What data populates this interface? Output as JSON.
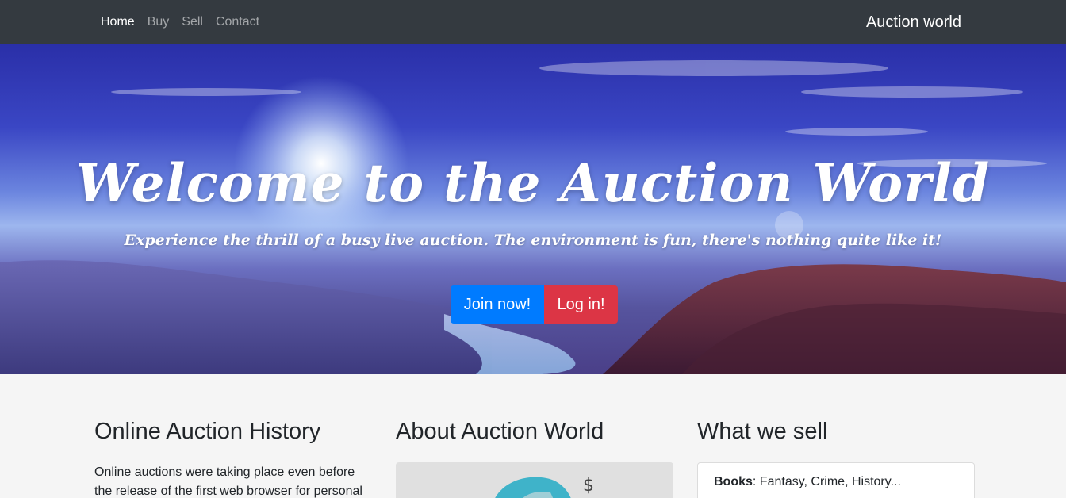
{
  "nav": {
    "links": [
      {
        "label": "Home",
        "active": true
      },
      {
        "label": "Buy",
        "active": false
      },
      {
        "label": "Sell",
        "active": false
      },
      {
        "label": "Contact",
        "active": false
      }
    ],
    "brand": "Auction world"
  },
  "hero": {
    "title": "Welcome to the Auction World",
    "subtitle": "Experience the thrill of a busy live auction. The environment is fun, there's nothing quite like it!",
    "join_button": "Join now!",
    "login_button": "Log in!"
  },
  "sections": {
    "history": {
      "heading": "Online Auction History",
      "text": "Online auctions were taking place even before the release of the first web browser for personal"
    },
    "about": {
      "heading": "About Auction World",
      "image_icons": [
        "globe-icon",
        "dollar-icon"
      ],
      "dollar_symbol": "$"
    },
    "sell": {
      "heading": "What we sell",
      "category_label": "Books",
      "category_text": ": Fantasy, Crime, History..."
    }
  },
  "colors": {
    "navbar": "#343a40",
    "primary": "#007bff",
    "danger": "#dc3545",
    "page_background": "#f5f5f5"
  }
}
